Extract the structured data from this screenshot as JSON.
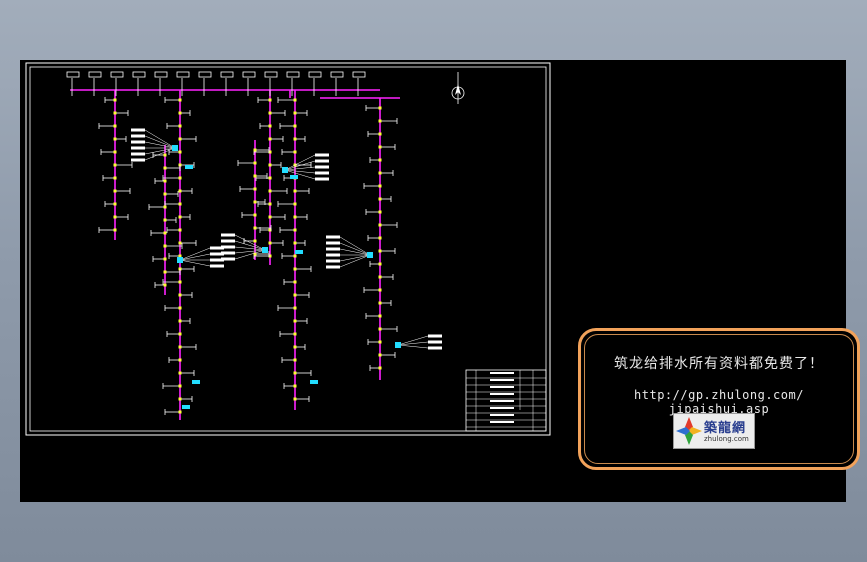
{
  "ad": {
    "title": "筑龙给排水所有资料都免费了！",
    "url": "http://gp.zhulong.com/ jipaishui.asp",
    "logo_name": "築龍網",
    "logo_domain": "zhulong.com"
  },
  "colors": {
    "pipe": "#ff22ff",
    "fixture": "#ffffff",
    "fitting": "#ffff33",
    "tag": "#22ddff",
    "frame": "#ffffff",
    "panel_border": "#f2a25a"
  },
  "icons": {
    "north_arrow": "compass-icon",
    "logo": "zhulong-logo-icon"
  }
}
